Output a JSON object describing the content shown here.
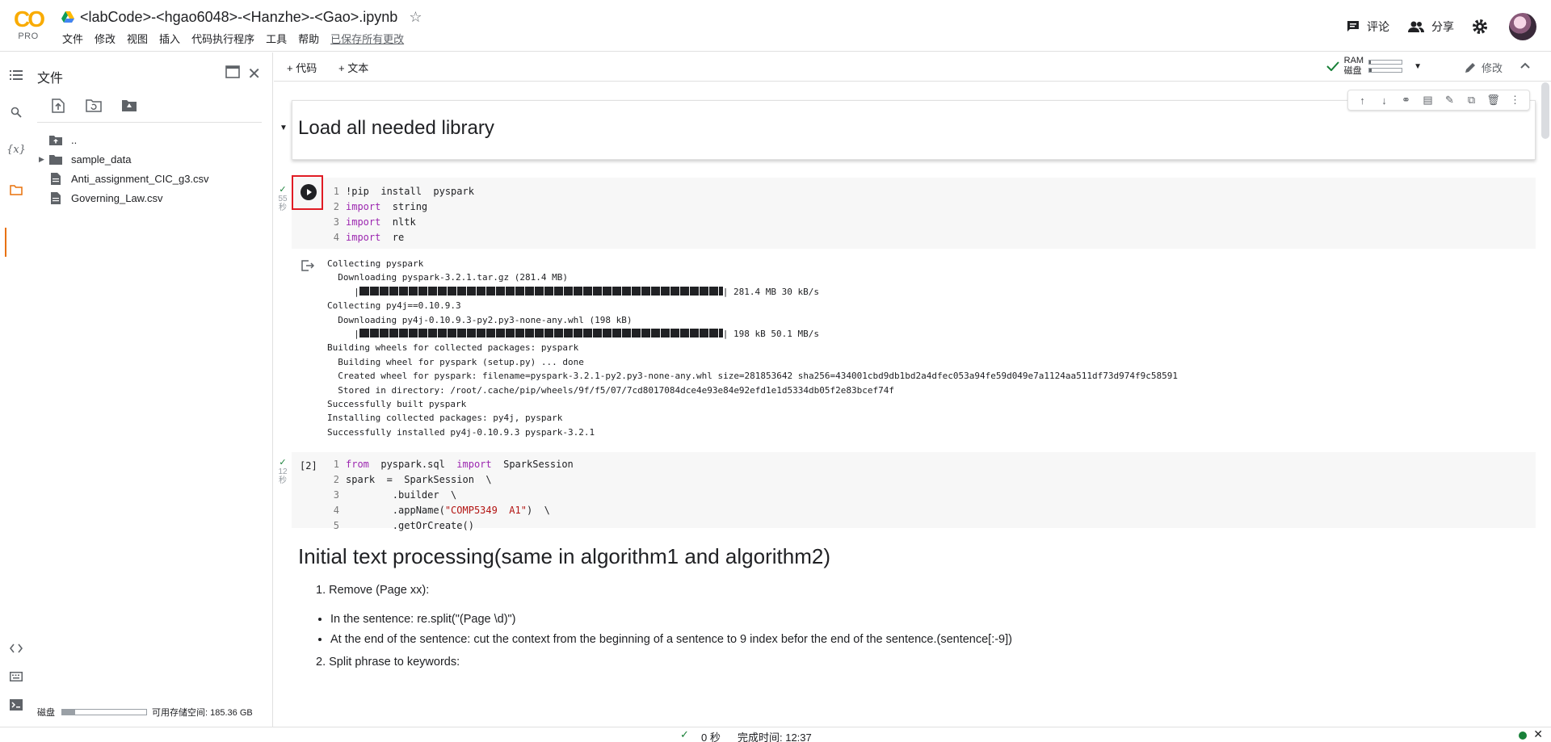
{
  "header": {
    "logo_text": "CO",
    "plan": "PRO",
    "title": "<labCode>-<hgao6048>-<Hanzhe>-<Gao>.ipynb",
    "menu": [
      "文件",
      "修改",
      "视图",
      "插入",
      "代码执行程序",
      "工具",
      "帮助"
    ],
    "saved_status": "已保存所有更改",
    "comment_label": "评论",
    "share_label": "分享"
  },
  "file_panel": {
    "title": "文件",
    "tree": [
      {
        "name": "..",
        "type": "parent"
      },
      {
        "name": "sample_data",
        "type": "folder"
      },
      {
        "name": "Anti_assignment_CIC_g3.csv",
        "type": "file"
      },
      {
        "name": "Governing_Law.csv",
        "type": "file"
      }
    ],
    "storage_label": "磁盘",
    "storage_free": "可用存储空间: 185.36 GB",
    "storage_used_fraction": 0.15
  },
  "toolbar": {
    "add_code": "+ 代码",
    "add_text": "+ 文本",
    "ram_label": "RAM",
    "disk_label": "磁盘",
    "ram_fraction": 0.05,
    "disk_fraction": 0.08,
    "edit_label": "修改"
  },
  "cells": {
    "heading1": "Load all needed library",
    "cell1_time": "55\n秒",
    "cell1_lines": [
      [
        "!pip  install  pyspark"
      ],
      [
        "import",
        "  string"
      ],
      [
        "import",
        "  nltk"
      ],
      [
        "import",
        "  re"
      ]
    ],
    "cell1_output": [
      "Collecting pyspark",
      "  Downloading pyspark-3.2.1.tar.gz (281.4 MB)",
      "| 281.4 MB 30 kB/s",
      "Collecting py4j==0.10.9.3",
      "  Downloading py4j-0.10.9.3-py2.py3-none-any.whl (198 kB)",
      "| 198 kB 50.1 MB/s",
      "Building wheels for collected packages: pyspark",
      "  Building wheel for pyspark (setup.py) ... done",
      "  Created wheel for pyspark: filename=pyspark-3.2.1-py2.py3-none-any.whl size=281853642 sha256=434001cbd9db1bd2a4dfec053a94fe59d049e7a1124aa511df73d974f9c58591",
      "  Stored in directory: /root/.cache/pip/wheels/9f/f5/07/7cd8017084dce4e93e84e92efd1e1d5334db05f2e83bcef74f",
      "Successfully built pyspark",
      "Installing collected packages: py4j, pyspark",
      "Successfully installed py4j-0.10.9.3 pyspark-3.2.1"
    ],
    "cell2_count": "[2]",
    "cell2_time": "12\n秒",
    "cell2": {
      "l1_kw1": "from",
      "l1_mod": "  pyspark.sql  ",
      "l1_kw2": "import",
      "l1_rest": "  SparkSession",
      "l2": "spark  =  SparkSession  \\",
      "l3": "        .builder  \\",
      "l4a": "        .appName(",
      "l4str": "\"COMP5349  A1\"",
      "l4b": ")  \\",
      "l5": "        .getOrCreate()"
    },
    "heading2": "Initial text processing(same in algorithm1 and algorithm2)",
    "md_item1": "1. Remove (Page xx):",
    "md_bullet1": "In the sentence: re.split(\"(Page \\d)\")",
    "md_bullet2": "At the end of the sentence: cut the context from the beginning of a sentence to 9 index befor the end of the sentence.(sentence[:-9])",
    "md_item2": "2. Split phrase to keywords:"
  },
  "status": {
    "time": "0 秒",
    "completed": "完成时间: 12:37"
  }
}
